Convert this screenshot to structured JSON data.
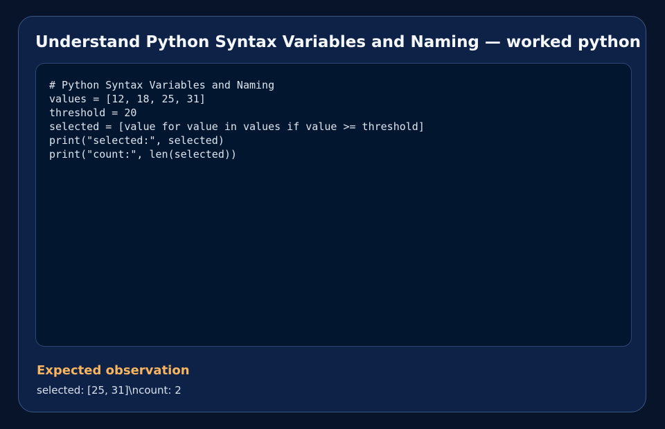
{
  "card": {
    "title": "Understand Python Syntax Variables and Naming — worked python example",
    "code": {
      "lines": [
        "# Python Syntax Variables and Naming",
        "values = [12, 18, 25, 31]",
        "threshold = 20",
        "selected = [value for value in values if value >= threshold]",
        "print(\"selected:\", selected)",
        "print(\"count:\", len(selected))"
      ]
    },
    "observation": {
      "heading": "Expected observation",
      "text": "selected: [25, 31]\\ncount: 2"
    }
  },
  "colors": {
    "page_background": "#08142a",
    "card_background": "#0e2247",
    "code_background": "#03162f",
    "accent": "#f7b560"
  }
}
